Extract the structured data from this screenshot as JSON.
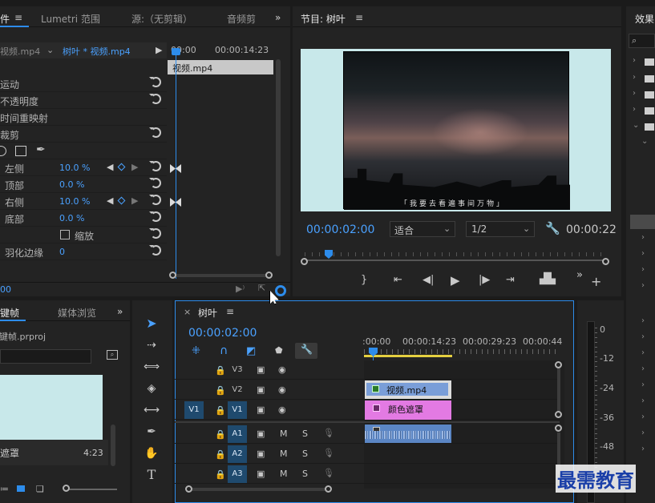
{
  "effect_controls": {
    "tabs": [
      "件",
      "Lumetri 范围",
      "源:（无剪辑）",
      "音频剪"
    ],
    "source_label": "视频.mp4",
    "sequence_label": "树叶 * 视频.mp4",
    "tl_times": [
      "00:00",
      "00:00:14:23"
    ],
    "clip_label": "视频.mp4",
    "rows": [
      {
        "label": "运动"
      },
      {
        "label": "不透明度"
      },
      {
        "label": "时间重映射"
      },
      {
        "label": "裁剪"
      },
      {
        "label": ""
      },
      {
        "label": "左侧",
        "value": "10.0 %"
      },
      {
        "label": "顶部",
        "value": "0.0 %"
      },
      {
        "label": "右侧",
        "value": "10.0 %"
      },
      {
        "label": "底部",
        "value": "0.0 %"
      },
      {
        "label": "缩放"
      },
      {
        "label": "羽化边缘",
        "value": "0"
      }
    ],
    "bottom_time": "00"
  },
  "program": {
    "title": "节目: 树叶",
    "subtitle": "「我要去看遍事间万物」",
    "timecode": "00:00:02:00",
    "fit": "适合",
    "ratio": "1/2",
    "duration": "00:00:22",
    "playhead": 0.08
  },
  "effects": {
    "title": "效果"
  },
  "project": {
    "tabs": [
      "关键帧",
      "媒体浏览"
    ],
    "file": "关键帧.prproj",
    "item_label": "遮罩",
    "item_duration": "4:23"
  },
  "timeline": {
    "title": "树叶",
    "timecode": "00:00:02:00",
    "ruler": [
      ":00:00",
      "00:00:14:23",
      "00:00:29:23",
      "00:00:44"
    ],
    "video_tracks": [
      "V3",
      "V2",
      "V1"
    ],
    "audio_tracks": [
      "A1",
      "A2",
      "A3"
    ],
    "source_v": "V1",
    "mute": "M",
    "solo": "S",
    "clip_v2": "视频.mp4",
    "clip_v1": "颜色遮罩"
  },
  "meter": {
    "ticks": [
      "0",
      "-12",
      "-24",
      "-36",
      "-48"
    ]
  },
  "watermark": "最需教育",
  "colors": {
    "accent": "#2d8ceb",
    "clip_video": "#7a9ed8",
    "clip_matte": "#e37ae3",
    "clip_audio": "#5b86c4"
  }
}
